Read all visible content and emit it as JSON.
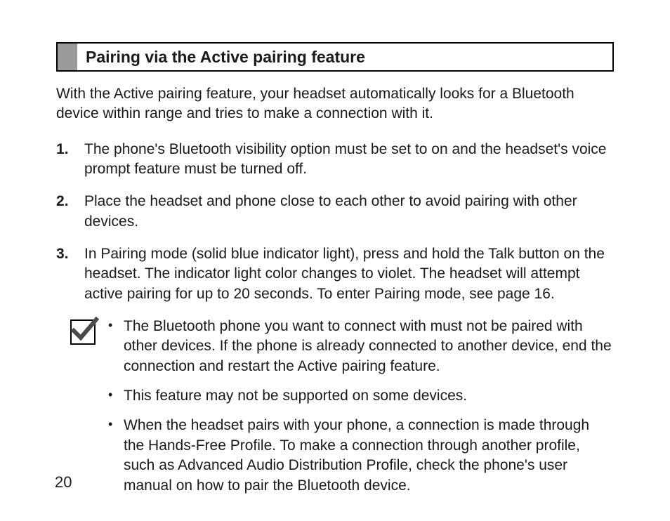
{
  "heading": "Pairing via the Active pairing feature",
  "intro": "With the Active pairing feature, your headset automatically looks for a Bluetooth device within range and tries to make a connection with it.",
  "steps": [
    "The phone's Bluetooth visibility option must be set to on and the headset's voice prompt feature must be turned off.",
    "Place the headset and phone close to each other to avoid pairing with other devices.",
    "In Pairing mode (solid blue indicator light), press and hold the Talk button on the headset. The indicator light color changes to violet. The headset will attempt active pairing for up to 20 seconds. To enter Pairing mode, see page 16."
  ],
  "notes": [
    "The Bluetooth phone you want to connect with must not be paired with other devices. If the phone is already connected to another device, end the connection and restart the Active pairing feature.",
    "This feature may not be supported on some devices.",
    "When the headset pairs with your phone, a connection is made through the Hands-Free Profile. To make a connection through another profile, such as Advanced Audio Distribution Profile, check the phone's user manual on how to pair the Bluetooth device."
  ],
  "pageNumber": "20"
}
